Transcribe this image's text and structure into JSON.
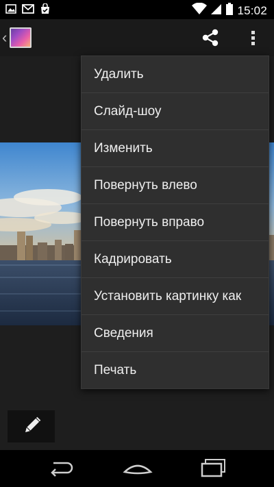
{
  "status_bar": {
    "time": "15:02",
    "left_icons": [
      "image-icon",
      "gmail-icon",
      "shopping-bag-icon"
    ],
    "right_icons": [
      "wifi-icon",
      "cell-signal-icon",
      "battery-icon"
    ]
  },
  "action_bar": {
    "icons": [
      "up-caret-icon",
      "gallery-app-icon",
      "share-icon",
      "overflow-menu-icon"
    ]
  },
  "menu": {
    "items": [
      "Удалить",
      "Слайд-шоу",
      "Изменить",
      "Повернуть влево",
      "Повернуть вправо",
      "Кадрировать",
      "Установить картинку как",
      "Сведения",
      "Печать"
    ]
  },
  "edit_button": {
    "icon": "pencil-icon"
  },
  "nav_bar": {
    "icons": [
      "back-icon",
      "home-icon",
      "recent-apps-icon"
    ]
  },
  "colors": {
    "menu_bg": "#2f2f2f",
    "menu_text": "#efefef",
    "screen_bg": "#1e1e1e"
  }
}
